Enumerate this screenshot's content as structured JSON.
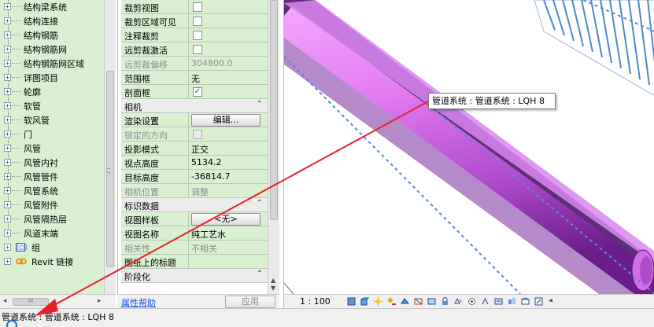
{
  "project_browser": {
    "items": [
      {
        "label": "结构梁系统",
        "expander": "+"
      },
      {
        "label": "结构连接",
        "expander": "+"
      },
      {
        "label": "结构钢筋",
        "expander": "+"
      },
      {
        "label": "结构钢筋网",
        "expander": "+"
      },
      {
        "label": "结构钢筋网区域",
        "expander": "+"
      },
      {
        "label": "详图项目",
        "expander": "+"
      },
      {
        "label": "轮廓",
        "expander": "+"
      },
      {
        "label": "软管",
        "expander": "+"
      },
      {
        "label": "软风管",
        "expander": "+"
      },
      {
        "label": "门",
        "expander": "+"
      },
      {
        "label": "风管",
        "expander": "+"
      },
      {
        "label": "风管内衬",
        "expander": "+"
      },
      {
        "label": "风管管件",
        "expander": "+"
      },
      {
        "label": "风管系统",
        "expander": "+"
      },
      {
        "label": "风管附件",
        "expander": "+"
      },
      {
        "label": "风管隔热层",
        "expander": "+"
      },
      {
        "label": "风道末端",
        "expander": "+"
      }
    ],
    "top_level": [
      {
        "label": "组",
        "expander": "+",
        "icon": "group-icon",
        "icon_glyph": "[○]"
      },
      {
        "label": "Revit 链接",
        "expander": "+",
        "icon": "link-icon"
      }
    ],
    "hscroll_left": "◂",
    "hscroll_right": "▸",
    "hscroll_thumb": "III"
  },
  "properties": {
    "rows_a": [
      {
        "name": "裁剪视图",
        "type": "checkbox",
        "checked": false
      },
      {
        "name": "裁剪区域可见",
        "type": "checkbox",
        "checked": false
      },
      {
        "name": "注释裁剪",
        "type": "checkbox",
        "checked": false
      },
      {
        "name": "远剪裁激活",
        "type": "checkbox",
        "checked": false
      },
      {
        "name": "远剪裁偏移",
        "type": "text",
        "value": "304800.0",
        "disabled": true
      },
      {
        "name": "范围框",
        "type": "text",
        "value": "无"
      },
      {
        "name": "剖面框",
        "type": "checkbox",
        "checked": true
      }
    ],
    "cat_camera": {
      "name": "相机",
      "chevron": "⌃"
    },
    "rows_b": [
      {
        "name": "渲染设置",
        "type": "button",
        "value": "编辑..."
      },
      {
        "name": "锁定的方向",
        "type": "checkbox",
        "checked": false,
        "disabled": true
      },
      {
        "name": "投影模式",
        "type": "text",
        "value": "正交"
      },
      {
        "name": "视点高度",
        "type": "text",
        "value": "5134.2"
      },
      {
        "name": "目标高度",
        "type": "text",
        "value": "-36814.7"
      },
      {
        "name": "相机位置",
        "type": "text",
        "value": "调整",
        "disabled": true
      }
    ],
    "cat_identity": {
      "name": "标识数据",
      "chevron": "⌃"
    },
    "rows_c": [
      {
        "name": "视图样板",
        "type": "button",
        "value": "<无>"
      },
      {
        "name": "视图名称",
        "type": "text",
        "value": "纯工艺水"
      },
      {
        "name": "相关性",
        "type": "text",
        "value": "不相关",
        "disabled": true
      },
      {
        "name": "图纸上的标题",
        "type": "text",
        "value": ""
      }
    ],
    "cat_phase": {
      "name": "阶段化",
      "chevron": "⌃"
    },
    "help_link": "属性帮助",
    "apply_button": "应用"
  },
  "view": {
    "tooltip": "管道系统 : 管道系统 : LQH 8",
    "scale": "1 : 100",
    "pipe_color": "#e27cf0",
    "pipe_dark": "#6a1c88",
    "duct_color": "#7fb0e8",
    "arrow_color": "#e8202a"
  },
  "status_bar": {
    "text": "管道系统 : 管道系统 : LQH 8"
  }
}
